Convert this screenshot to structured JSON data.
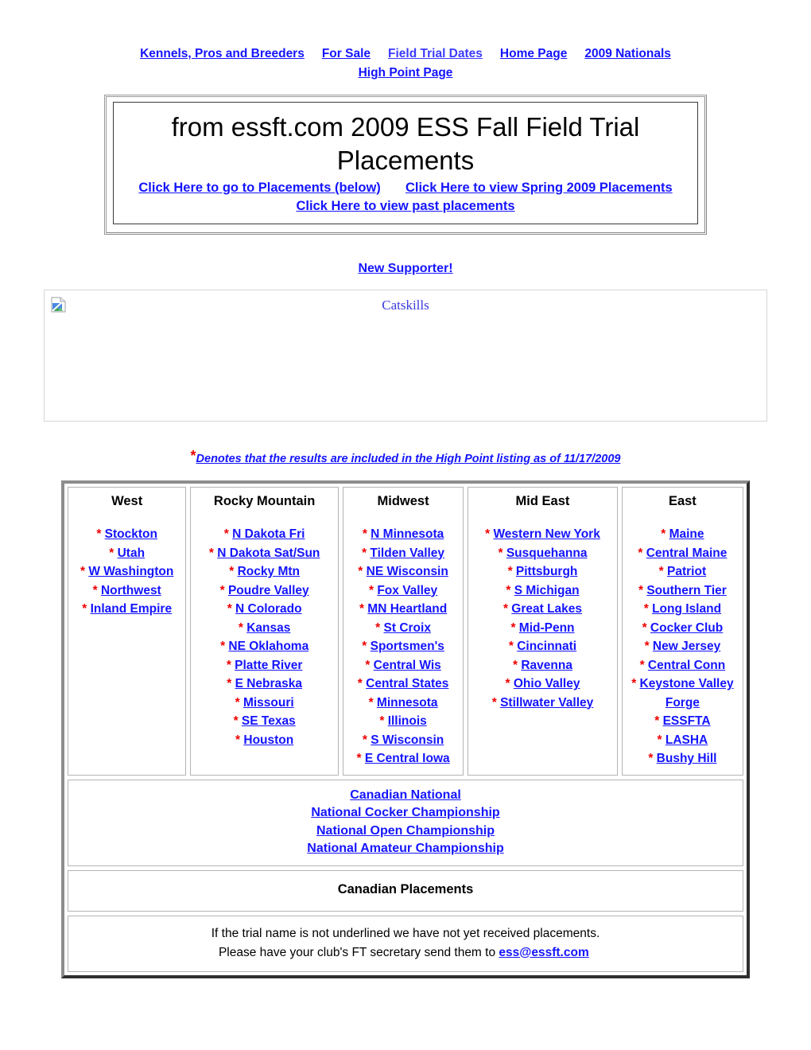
{
  "nav": {
    "links": [
      {
        "label": "Kennels, Pros and Breeders",
        "visited": false
      },
      {
        "label": "For Sale",
        "visited": false
      },
      {
        "label": "Field Trial Dates",
        "visited": true
      },
      {
        "label": "Home Page",
        "visited": false
      },
      {
        "label": "2009 Nationals",
        "visited": false
      }
    ],
    "second_row": "High Point Page"
  },
  "title_box": {
    "heading_line1": "from essft.com 2009 ESS Fall Field Trial",
    "heading_line2": "Placements",
    "link_placements_below": "Click Here to go to Placements (below)",
    "link_spring": "Click Here to view Spring 2009 Placements",
    "link_past": "Click Here to view past placements"
  },
  "supporter": {
    "label": "New Supporter!"
  },
  "banner": {
    "caption": "Catskills",
    "icon": "broken-image-icon"
  },
  "denotes": {
    "star": "*",
    "text": "Denotes that the results are included in the High Point listing as of 11/17/2009"
  },
  "colors": {
    "link": "#1414ff",
    "star": "#ee0000",
    "text": "#000000",
    "table_border_light": "#8d8d8d",
    "table_border_dark": "#2e2e2e",
    "cell_border": "#b4b4b4"
  },
  "placements": {
    "columns": [
      {
        "header": "West",
        "items": [
          {
            "star": "*",
            "name": "Stockton"
          },
          {
            "star": "*",
            "name": "Utah"
          },
          {
            "star": "*",
            "name": "W Washington"
          },
          {
            "star": "*",
            "name": "Northwest"
          },
          {
            "star": "*",
            "name": "Inland Empire"
          }
        ]
      },
      {
        "header": "Rocky Mountain",
        "items": [
          {
            "star": "*",
            "name": "N Dakota Fri"
          },
          {
            "star": "*",
            "name": "N Dakota Sat/Sun"
          },
          {
            "star": "*",
            "name": "Rocky Mtn"
          },
          {
            "star": "*",
            "name": "Poudre Valley"
          },
          {
            "star": "*",
            "name": "N Colorado"
          },
          {
            "star": "*",
            "name": "Kansas"
          },
          {
            "star": "*",
            "name": "NE Oklahoma"
          },
          {
            "star": "*",
            "name": "Platte River"
          },
          {
            "star": "*",
            "name": "E Nebraska"
          },
          {
            "star": "*",
            "name": "Missouri"
          },
          {
            "star": "*",
            "name": "SE Texas"
          },
          {
            "star": "*",
            "name": "Houston"
          }
        ]
      },
      {
        "header": "Midwest",
        "items": [
          {
            "star": "*",
            "name": "N Minnesota"
          },
          {
            "star": "*",
            "name": "Tilden Valley"
          },
          {
            "star": "*",
            "name": "NE Wisconsin"
          },
          {
            "star": "*",
            "name": "Fox Valley"
          },
          {
            "star": "*",
            "name": "MN Heartland"
          },
          {
            "star": "*",
            "name": "St Croix"
          },
          {
            "star": "*",
            "name": "Sportsmen's"
          },
          {
            "star": "*",
            "name": "Central Wis"
          },
          {
            "star": "*",
            "name": "Central States"
          },
          {
            "star": "*",
            "name": "Minnesota"
          },
          {
            "star": "*",
            "name": "Illinois"
          },
          {
            "star": "*",
            "name": "S Wisconsin"
          },
          {
            "star": "*",
            "name": "E Central Iowa"
          }
        ]
      },
      {
        "header": "Mid East",
        "items": [
          {
            "star": "*",
            "name": "Western New York"
          },
          {
            "star": "*",
            "name": "Susquehanna"
          },
          {
            "star": "*",
            "name": "Pittsburgh"
          },
          {
            "star": "*",
            "name": "S Michigan"
          },
          {
            "star": "*",
            "name": "Great Lakes"
          },
          {
            "star": "*",
            "name": "Mid-Penn"
          },
          {
            "star": "*",
            "name": "Cincinnati"
          },
          {
            "star": "*",
            "name": "Ravenna"
          },
          {
            "star": "*",
            "name": "Ohio Valley"
          },
          {
            "star": "*",
            "name": "Stillwater Valley"
          }
        ]
      },
      {
        "header": "East",
        "items": [
          {
            "star": "*",
            "name": "Maine"
          },
          {
            "star": "*",
            "name": "Central Maine"
          },
          {
            "star": "*",
            "name": "Patriot"
          },
          {
            "star": "*",
            "name": "Southern Tier"
          },
          {
            "star": "*",
            "name": "Long Island"
          },
          {
            "star": "*",
            "name": "Cocker Club"
          },
          {
            "star": "*",
            "name": "New Jersey"
          },
          {
            "star": "*",
            "name": "Central Conn"
          },
          {
            "star": "*",
            "name": "Keystone Valley Forge"
          },
          {
            "star": "*",
            "name": "ESSFTA"
          },
          {
            "star": "*",
            "name": "LASHA"
          },
          {
            "star": "*",
            "name": "Bushy Hill"
          }
        ]
      }
    ],
    "nationals": [
      "Canadian National",
      "National Cocker Championship",
      "National Open Championship",
      "National Amateur Championship"
    ],
    "canadian_placements": "Canadian Placements",
    "note_line1": "If the trial name is not underlined we have not yet received placements.",
    "note_line2_prefix": "Please have your club's FT secretary send them to ",
    "note_email": "ess@essft.com"
  }
}
